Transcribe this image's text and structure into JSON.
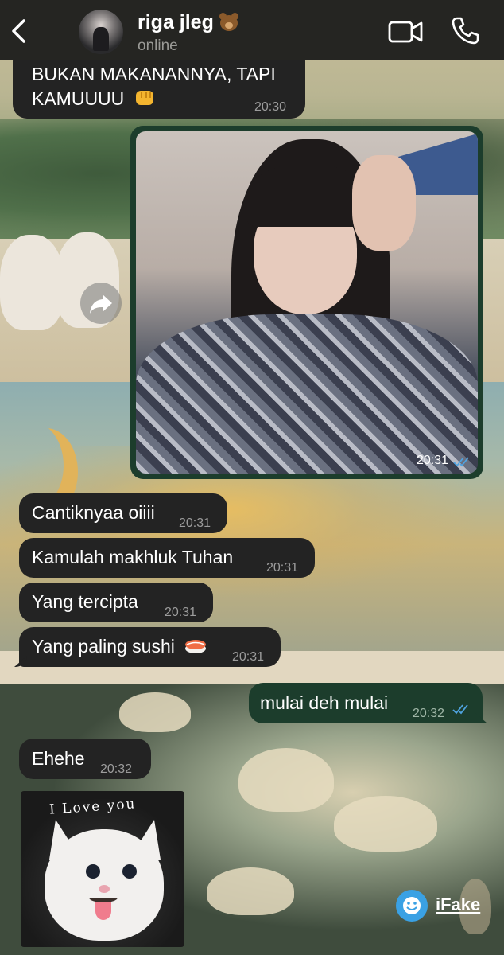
{
  "header": {
    "contact_name": "riga jleg",
    "contact_emoji": "bear-emoji",
    "status": "online",
    "icons": [
      "back-chevron-icon",
      "video-camera-icon",
      "phone-icon"
    ]
  },
  "messages": [
    {
      "direction": "incoming",
      "lines": [
        "BUKAN MAKANANNYA, TAPI",
        "KAMUUUU"
      ],
      "emoji": "oncoming-fist-emoji",
      "time": "20:30"
    },
    {
      "direction": "outgoing",
      "type": "image",
      "time": "20:31",
      "status": "read"
    },
    {
      "direction": "incoming",
      "text": "Cantiknyaa oiiii",
      "time": "20:31"
    },
    {
      "direction": "incoming",
      "text": "Kamulah makhluk Tuhan",
      "time": "20:31"
    },
    {
      "direction": "incoming",
      "text": "Yang tercipta",
      "time": "20:31"
    },
    {
      "direction": "incoming",
      "text": "Yang paling sushi",
      "emoji": "sushi-emoji",
      "time": "20:31"
    },
    {
      "direction": "outgoing",
      "text": "mulai deh mulai",
      "time": "20:32",
      "status": "read"
    },
    {
      "direction": "incoming",
      "text": "Ehehe",
      "time": "20:32"
    },
    {
      "direction": "incoming",
      "type": "sticker",
      "sticker_text": "I Love you"
    }
  ],
  "watermark": {
    "text": "iFake"
  },
  "colors": {
    "header_bg": "#252522",
    "incoming_bubble": "#232323",
    "outgoing_bubble": "#1c3d2c",
    "read_ticks": "#4fa3e0"
  }
}
